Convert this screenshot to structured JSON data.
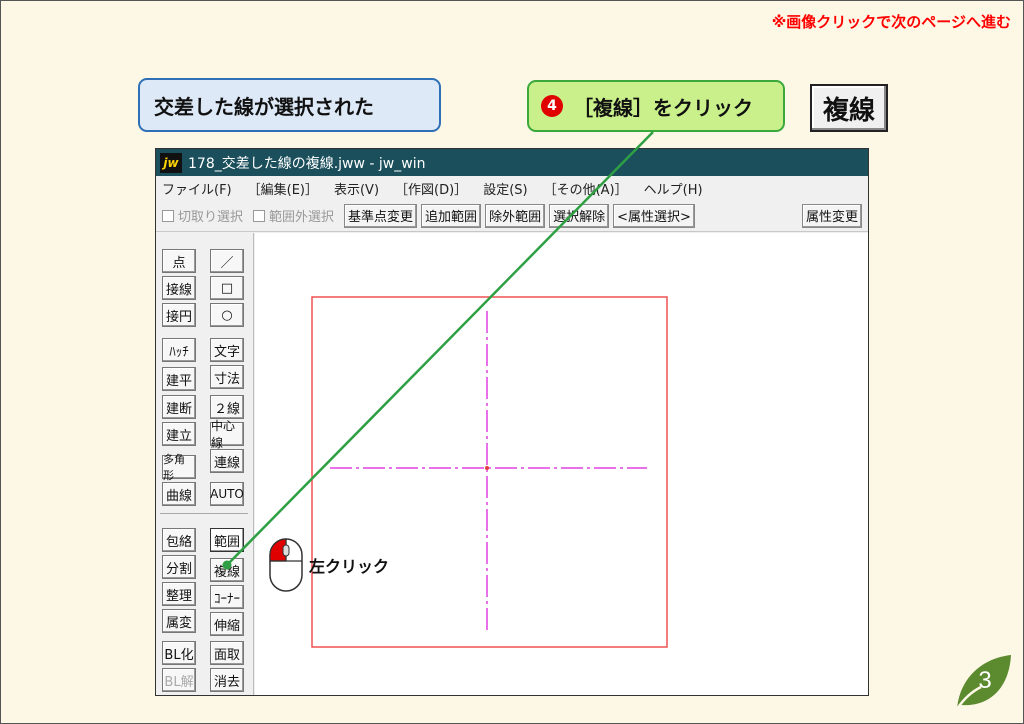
{
  "header": {
    "note": "※画像クリックで次のページへ進む",
    "callout_left": "交差した線が選択された",
    "callout_right_num": "4",
    "callout_right": "［複線］をクリック",
    "big_button": "複線"
  },
  "window": {
    "title": "178_交差した線の複線.jww - jw_win",
    "logo": "jw",
    "menu": [
      "ファイル(F)",
      "［編集(E)］",
      "表示(V)",
      "［作図(D)］",
      "設定(S)",
      "［その他(A)］",
      "ヘルプ(H)"
    ],
    "toolbar": {
      "chk1": "切取り選択",
      "chk2": "範囲外選択",
      "buttons": [
        "基準点変更",
        "追加範囲",
        "除外範囲",
        "選択解除",
        "<属性選択>"
      ],
      "right_button": "属性変更"
    },
    "left_col1": [
      "点",
      "接線",
      "接円",
      "ﾊｯﾁ",
      "建平",
      "建断",
      "建立",
      "多角形",
      "曲線",
      "包絡",
      "分割",
      "整理",
      "属変",
      "BL化",
      "BL解"
    ],
    "left_col2_icons": [
      "／",
      "□",
      "○"
    ],
    "left_col2": [
      "文字",
      "寸法",
      "２線",
      "中心線",
      "連線",
      "AUTO",
      "範囲",
      "複線",
      "ｺｰﾅｰ",
      "伸縮",
      "面取",
      "消去"
    ]
  },
  "mouse_label": "左クリック",
  "page_number": "3",
  "colors": {
    "title_bg": "#1b4f5c",
    "rect_line": "#f05050",
    "dashdot_line": "#e040e0",
    "pointer_line": "#2ea043",
    "step_num_bg": "#e00000",
    "badge": "#5c8a2e"
  }
}
